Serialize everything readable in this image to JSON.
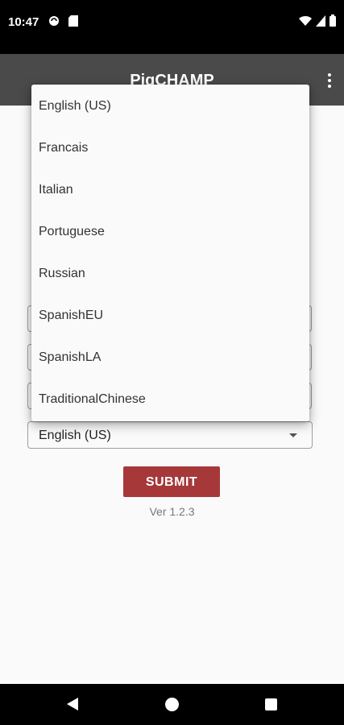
{
  "status_bar": {
    "time": "10:47",
    "left_icons": [
      "cast-icon",
      "sd-card-icon"
    ],
    "right_icons": [
      "wifi-icon",
      "signal-icon",
      "battery-icon"
    ]
  },
  "app_bar": {
    "title": "PigCHAMP",
    "overflow_icon": "more-vert-icon"
  },
  "form": {
    "language_select": {
      "selected": "English (US)"
    },
    "submit_label": "SUBMIT",
    "version": "Ver 1.2.3"
  },
  "dropdown": {
    "options": [
      "English (US)",
      "Francais",
      "Italian",
      "Portuguese",
      "Russian",
      "SpanishEU",
      "SpanishLA",
      "TraditionalChinese"
    ]
  },
  "nav_bar": {
    "icons": [
      "back-icon",
      "home-icon",
      "recents-icon"
    ]
  },
  "colors": {
    "app_bar": "#4a4a4a",
    "submit": "#a6383a",
    "background": "#fafafa"
  }
}
